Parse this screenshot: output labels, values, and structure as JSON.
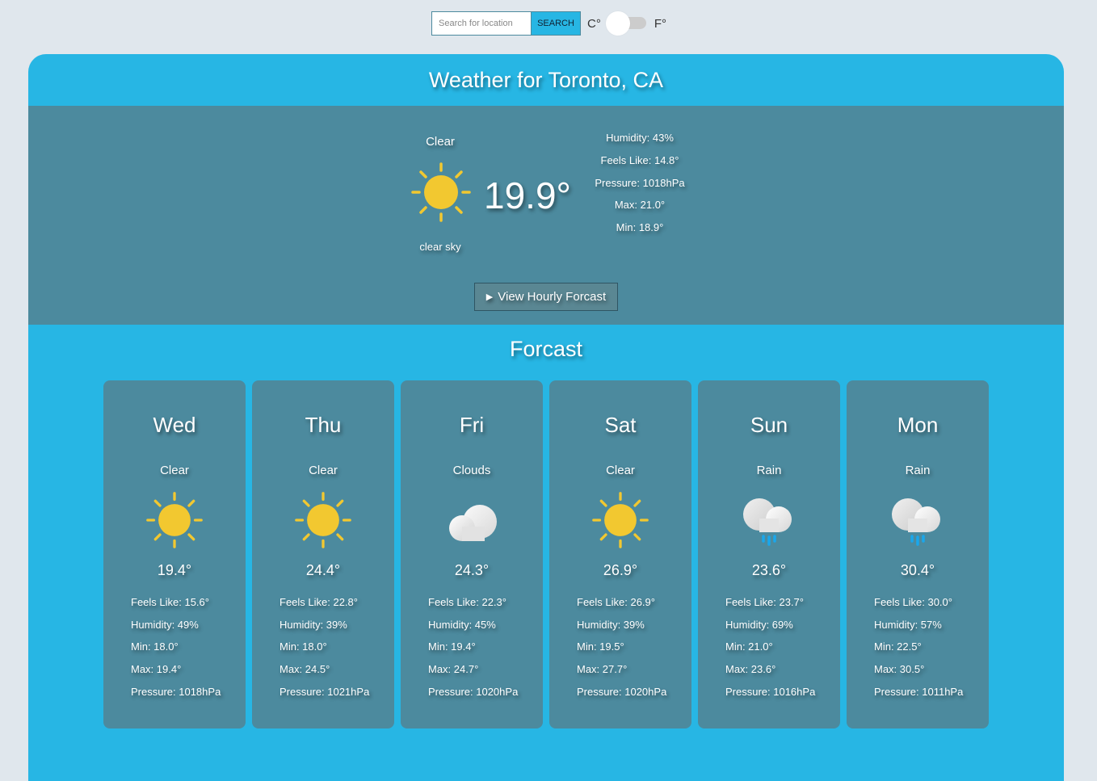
{
  "search": {
    "placeholder": "Search for location",
    "value": "",
    "button_label": "SEARCH"
  },
  "units": {
    "celsius_label": "C°",
    "fahrenheit_label": "F°",
    "selected": "C"
  },
  "title": "Weather for Toronto, CA",
  "current": {
    "condition": "Clear",
    "icon": "sun-icon",
    "temperature": "19.9°",
    "description": "clear sky",
    "humidity": "Humidity: 43%",
    "feels_like": "Feels Like: 14.8°",
    "pressure": "Pressure: 1018hPa",
    "max": "Max: 21.0°",
    "min": "Min: 18.9°"
  },
  "hourly_button_label": "View Hourly Forcast",
  "forecast_title": "Forcast",
  "colors": {
    "page_bg": "#e0e7ed",
    "accent": "#27b6e4",
    "panel": "#4c8a9e",
    "sun": "#f2c830",
    "rain": "#1aa7ec"
  },
  "forecast": [
    {
      "day": "Wed",
      "condition": "Clear",
      "icon": "sun-icon",
      "temp": "19.4°",
      "feels_like": "Feels Like: 15.6°",
      "humidity": "Humidity: 49%",
      "min": "Min: 18.0°",
      "max": "Max: 19.4°",
      "pressure": "Pressure: 1018hPa"
    },
    {
      "day": "Thu",
      "condition": "Clear",
      "icon": "sun-icon",
      "temp": "24.4°",
      "feels_like": "Feels Like: 22.8°",
      "humidity": "Humidity: 39%",
      "min": "Min: 18.0°",
      "max": "Max: 24.5°",
      "pressure": "Pressure: 1021hPa"
    },
    {
      "day": "Fri",
      "condition": "Clouds",
      "icon": "cloud-icon",
      "temp": "24.3°",
      "feels_like": "Feels Like: 22.3°",
      "humidity": "Humidity: 45%",
      "min": "Min: 19.4°",
      "max": "Max: 24.7°",
      "pressure": "Pressure: 1020hPa"
    },
    {
      "day": "Sat",
      "condition": "Clear",
      "icon": "sun-icon",
      "temp": "26.9°",
      "feels_like": "Feels Like: 26.9°",
      "humidity": "Humidity: 39%",
      "min": "Min: 19.5°",
      "max": "Max: 27.7°",
      "pressure": "Pressure: 1020hPa"
    },
    {
      "day": "Sun",
      "condition": "Rain",
      "icon": "rain-icon",
      "temp": "23.6°",
      "feels_like": "Feels Like: 23.7°",
      "humidity": "Humidity: 69%",
      "min": "Min: 21.0°",
      "max": "Max: 23.6°",
      "pressure": "Pressure: 1016hPa"
    },
    {
      "day": "Mon",
      "condition": "Rain",
      "icon": "rain-icon",
      "temp": "30.4°",
      "feels_like": "Feels Like: 30.0°",
      "humidity": "Humidity: 57%",
      "min": "Min: 22.5°",
      "max": "Max: 30.5°",
      "pressure": "Pressure: 1011hPa"
    }
  ]
}
